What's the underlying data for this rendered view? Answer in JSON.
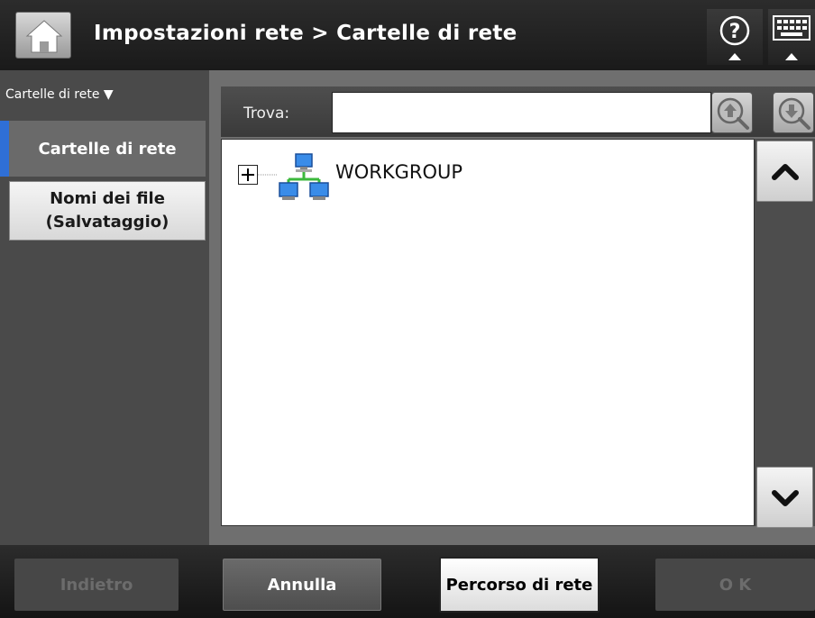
{
  "header": {
    "title": "Impostazioni rete > Cartelle di rete",
    "home_icon": "home-icon",
    "help_icon": "help-icon",
    "keyboard_icon": "keyboard-icon"
  },
  "sidebar": {
    "header": "Cartelle di rete ▼",
    "items": [
      {
        "label": "Cartelle di rete",
        "selected": true
      },
      {
        "label_line1": "Nomi dei file",
        "label_line2": "(Salvataggio)",
        "selected": false
      }
    ]
  },
  "search": {
    "label": "Trova:",
    "value": "",
    "prev_icon": "find-previous-icon",
    "next_icon": "find-next-icon"
  },
  "tree": {
    "nodes": [
      {
        "label": "WORKGROUP",
        "expanded": false,
        "icon": "network-icon"
      }
    ]
  },
  "footer": {
    "back_label": "Indietro",
    "cancel_label": "Annulla",
    "network_path_label": "Percorso di rete",
    "ok_label": "O K"
  },
  "colors": {
    "accent": "#2f6fd6",
    "header_bg": "#1a1a1a",
    "panel_bg": "#6f6f6f"
  }
}
